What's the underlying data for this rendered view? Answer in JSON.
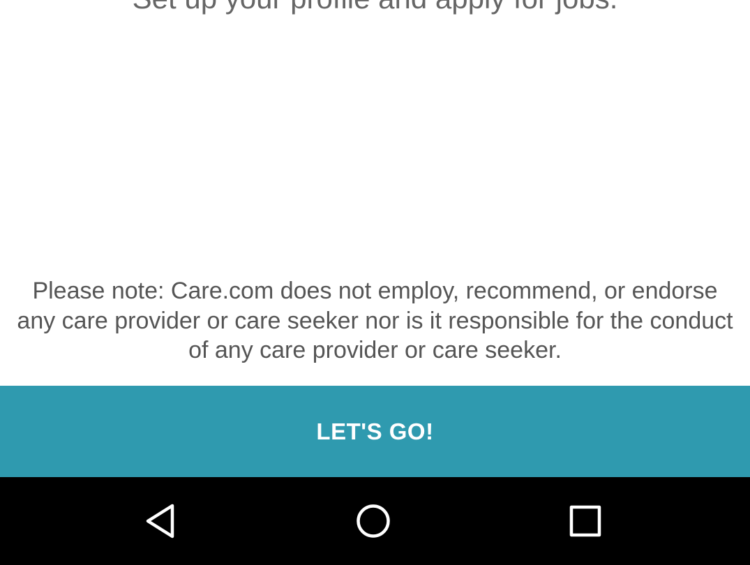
{
  "onboarding": {
    "subtitle": "Set up your profile and apply for jobs.",
    "disclaimer": "Please note: Care.com does not employ, recommend, or endorse any care provider or care seeker nor is it responsible for the conduct of any care provider or care seeker.",
    "cta_label": "LET'S GO!"
  },
  "colors": {
    "accent": "#2f9aaf",
    "navbar": "#000000",
    "text": "#555555"
  },
  "navbar": {
    "icons": [
      "back-icon",
      "home-icon",
      "recents-icon"
    ]
  }
}
